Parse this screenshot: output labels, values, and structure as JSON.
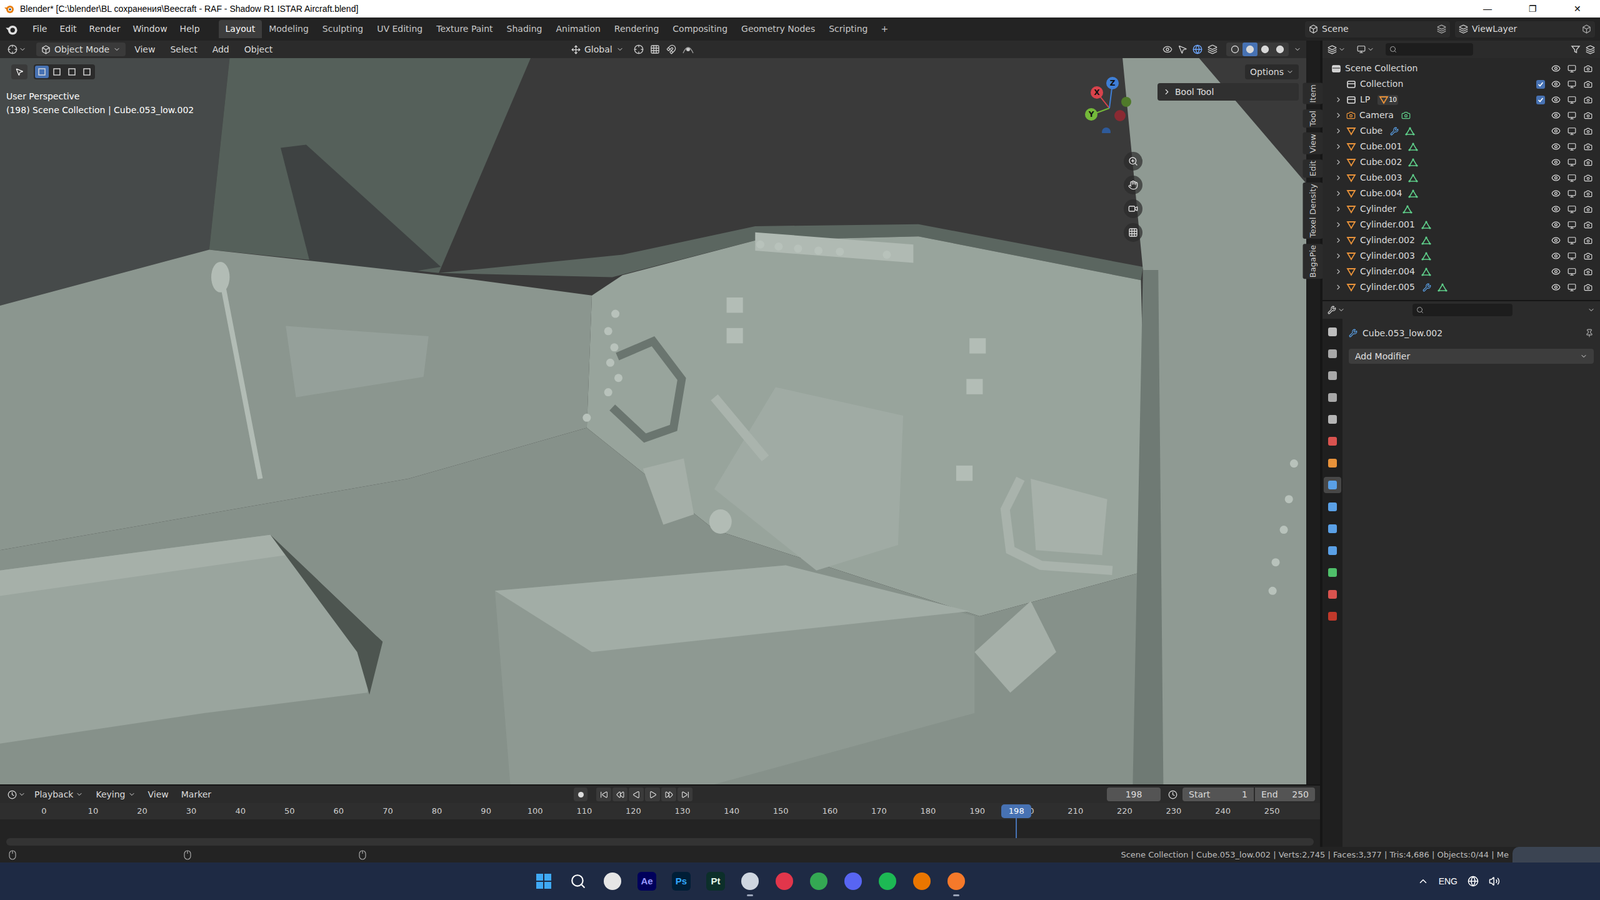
{
  "window": {
    "title": "Blender* [C:\\blender\\BL сохранения\\Beecraft - RAF - Shadow R1 ISTAR Aircraft.blend]",
    "controls": [
      "—",
      "❐",
      "✕"
    ]
  },
  "menu": [
    "File",
    "Edit",
    "Render",
    "Window",
    "Help"
  ],
  "workspaces": [
    {
      "label": "Layout",
      "selected": true
    },
    {
      "label": "Modeling",
      "selected": false
    },
    {
      "label": "Sculpting",
      "selected": false
    },
    {
      "label": "UV Editing",
      "selected": false
    },
    {
      "label": "Texture Paint",
      "selected": false
    },
    {
      "label": "Shading",
      "selected": false
    },
    {
      "label": "Animation",
      "selected": false
    },
    {
      "label": "Rendering",
      "selected": false
    },
    {
      "label": "Compositing",
      "selected": false
    },
    {
      "label": "Geometry Nodes",
      "selected": false
    },
    {
      "label": "Scripting",
      "selected": false
    }
  ],
  "add_workspace": "+",
  "scene": "Scene",
  "view_layer": "ViewLayer",
  "viewport": {
    "mode": "Object Mode",
    "menus": [
      "View",
      "Select",
      "Add",
      "Object"
    ],
    "orientation": "Global",
    "options": "Options",
    "perspective": "User Perspective",
    "info": "(198) Scene Collection | Cube.053_low.002",
    "panel": "Bool Tool",
    "gizmo": [
      {
        "label": "X",
        "color": "#d9434c"
      },
      {
        "label": "Y",
        "color": "#74b93a"
      },
      {
        "label": "Z",
        "color": "#3f7fd6"
      }
    ],
    "shading": [
      {
        "selected": false
      },
      {
        "selected": true
      },
      {
        "selected": false
      },
      {
        "selected": false
      }
    ],
    "tabs": [
      "Item",
      "Tool",
      "View",
      "Edit",
      "Texel Density",
      "BagaPie"
    ]
  },
  "outliner": {
    "rows": [
      {
        "label": "Scene Collection",
        "kind": "scene",
        "expandable": false,
        "visible": true
      },
      {
        "label": "Collection",
        "kind": "collection",
        "expandable": false,
        "checked": true,
        "visible": true
      },
      {
        "label": "LP",
        "kind": "collection",
        "expandable": true,
        "checked": true,
        "badge": "10",
        "visible": true
      },
      {
        "label": "Camera",
        "kind": "camera",
        "expandable": true,
        "modifier": false,
        "visible": true
      },
      {
        "label": "Cube",
        "kind": "mesh",
        "expandable": true,
        "modifier": true,
        "visible": true
      },
      {
        "label": "Cube.001",
        "kind": "mesh",
        "expandable": true,
        "modifier": false,
        "visible": true
      },
      {
        "label": "Cube.002",
        "kind": "mesh",
        "expandable": true,
        "modifier": false,
        "visible": true
      },
      {
        "label": "Cube.003",
        "kind": "mesh",
        "expandable": true,
        "modifier": false,
        "visible": true
      },
      {
        "label": "Cube.004",
        "kind": "mesh",
        "expandable": true,
        "modifier": false,
        "visible": true
      },
      {
        "label": "Cylinder",
        "kind": "mesh",
        "expandable": true,
        "modifier": false,
        "visible": true
      },
      {
        "label": "Cylinder.001",
        "kind": "mesh",
        "expandable": true,
        "modifier": false,
        "visible": true
      },
      {
        "label": "Cylinder.002",
        "kind": "mesh",
        "expandable": true,
        "modifier": false,
        "visible": true
      },
      {
        "label": "Cylinder.003",
        "kind": "mesh",
        "expandable": true,
        "modifier": false,
        "visible": true
      },
      {
        "label": "Cylinder.004",
        "kind": "mesh",
        "expandable": true,
        "modifier": false,
        "visible": true
      },
      {
        "label": "Cylinder.005",
        "kind": "mesh",
        "expandable": true,
        "modifier": true,
        "visible": true
      }
    ]
  },
  "properties": {
    "object": "Cube.053_low.002",
    "add_modifier": "Add Modifier",
    "tabs": [
      {
        "color": "#bdbdbd",
        "selected": false
      },
      {
        "color": "#a8a8a8",
        "selected": false
      },
      {
        "color": "#a8a8a8",
        "selected": false
      },
      {
        "color": "#a8a8a8",
        "selected": false
      },
      {
        "color": "#b5b5b5",
        "selected": false
      },
      {
        "color": "#d9534f",
        "selected": false
      },
      {
        "color": "#e8923a",
        "selected": false
      },
      {
        "color": "#5aa0e6",
        "selected": true
      },
      {
        "color": "#5aa0e6",
        "selected": false
      },
      {
        "color": "#5aa0e6",
        "selected": false
      },
      {
        "color": "#5aa0e6",
        "selected": false
      },
      {
        "color": "#4fbf6a",
        "selected": false
      },
      {
        "color": "#d9534f",
        "selected": false
      },
      {
        "color": "#c0392b",
        "selected": false
      }
    ]
  },
  "timeline": {
    "menus": [
      "Playback",
      "Keying",
      "View",
      "Marker"
    ],
    "current_frame": "198",
    "start_label": "Start",
    "start": "1",
    "end_label": "End",
    "end": "250",
    "ticks": [
      "0",
      "10",
      "20",
      "30",
      "40",
      "50",
      "60",
      "70",
      "80",
      "90",
      "100",
      "110",
      "120",
      "130",
      "140",
      "150",
      "160",
      "170",
      "180",
      "190",
      "200",
      "210",
      "220",
      "230",
      "240",
      "250"
    ]
  },
  "status_bar": {
    "text": "Scene Collection | Cube.053_low.002 | Verts:2,745 | Faces:3,377 | Tris:4,686 | Objects:0/44 | Me"
  },
  "taskbar": {
    "apps": [
      {
        "kind": "windows",
        "active": false
      },
      {
        "kind": "search",
        "active": false
      },
      {
        "kind": "app",
        "color": "#e6e6e6",
        "active": false
      },
      {
        "kind": "badge",
        "label": "Ae",
        "color": "#00005b",
        "text_color": "#9999ff",
        "active": false
      },
      {
        "kind": "badge",
        "label": "Ps",
        "color": "#001e36",
        "text_color": "#31a8ff",
        "active": false
      },
      {
        "kind": "badge",
        "label": "Pt",
        "color": "#0c2f2a",
        "text_color": "#e2f5e8",
        "active": false
      },
      {
        "kind": "app",
        "color": "#cfd6e0",
        "active": true
      },
      {
        "kind": "app",
        "color": "#e2364b",
        "active": false
      },
      {
        "kind": "app",
        "color": "#34a853",
        "active": false
      },
      {
        "kind": "app",
        "color": "#5865f2",
        "active": false
      },
      {
        "kind": "app",
        "color": "#1db954",
        "active": false
      },
      {
        "kind": "app",
        "color": "#ea7600",
        "active": false
      },
      {
        "kind": "app",
        "color": "#f5792a",
        "active": true
      }
    ],
    "language": "ENG"
  }
}
